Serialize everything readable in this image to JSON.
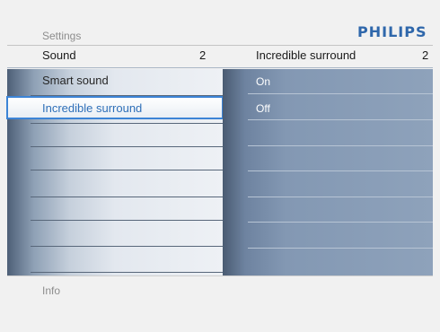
{
  "breadcrumb": "Settings",
  "logo": "PHILIPS",
  "header": {
    "left_label": "Sound",
    "left_count": "2",
    "right_label": "Incredible surround",
    "right_count": "2"
  },
  "menu": {
    "items": [
      {
        "label": "Smart sound"
      },
      {
        "label": "Incredible surround"
      }
    ],
    "selected_index": 1
  },
  "options": {
    "items": [
      {
        "label": "On"
      },
      {
        "label": "Off"
      }
    ]
  },
  "footer": {
    "info_label": "Info"
  },
  "colors": {
    "logo": "#2f67ab",
    "highlight_border": "#3c84d6",
    "selected_text": "#2e6fb8"
  }
}
